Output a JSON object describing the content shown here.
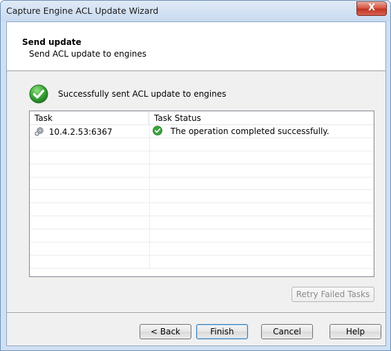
{
  "window": {
    "title": "Capture Engine ACL Update Wizard",
    "close_label": "X"
  },
  "header": {
    "title": "Send update",
    "subtitle": "Send ACL update to engines"
  },
  "status": {
    "message": "Successfully sent ACL update to engines"
  },
  "table": {
    "columns": [
      "Task",
      "Task Status"
    ],
    "rows": [
      {
        "task": "10.4.2.53:6367",
        "status": "The operation completed successfully."
      }
    ],
    "empty_row_count": 10
  },
  "buttons": {
    "retry": "Retry Failed Tasks",
    "back": "< Back",
    "finish": "Finish",
    "cancel": "Cancel",
    "help": "Help"
  },
  "colors": {
    "success_green": "#3aa53a",
    "title_bar": "#c8daf0",
    "close_red": "#c0321f"
  }
}
